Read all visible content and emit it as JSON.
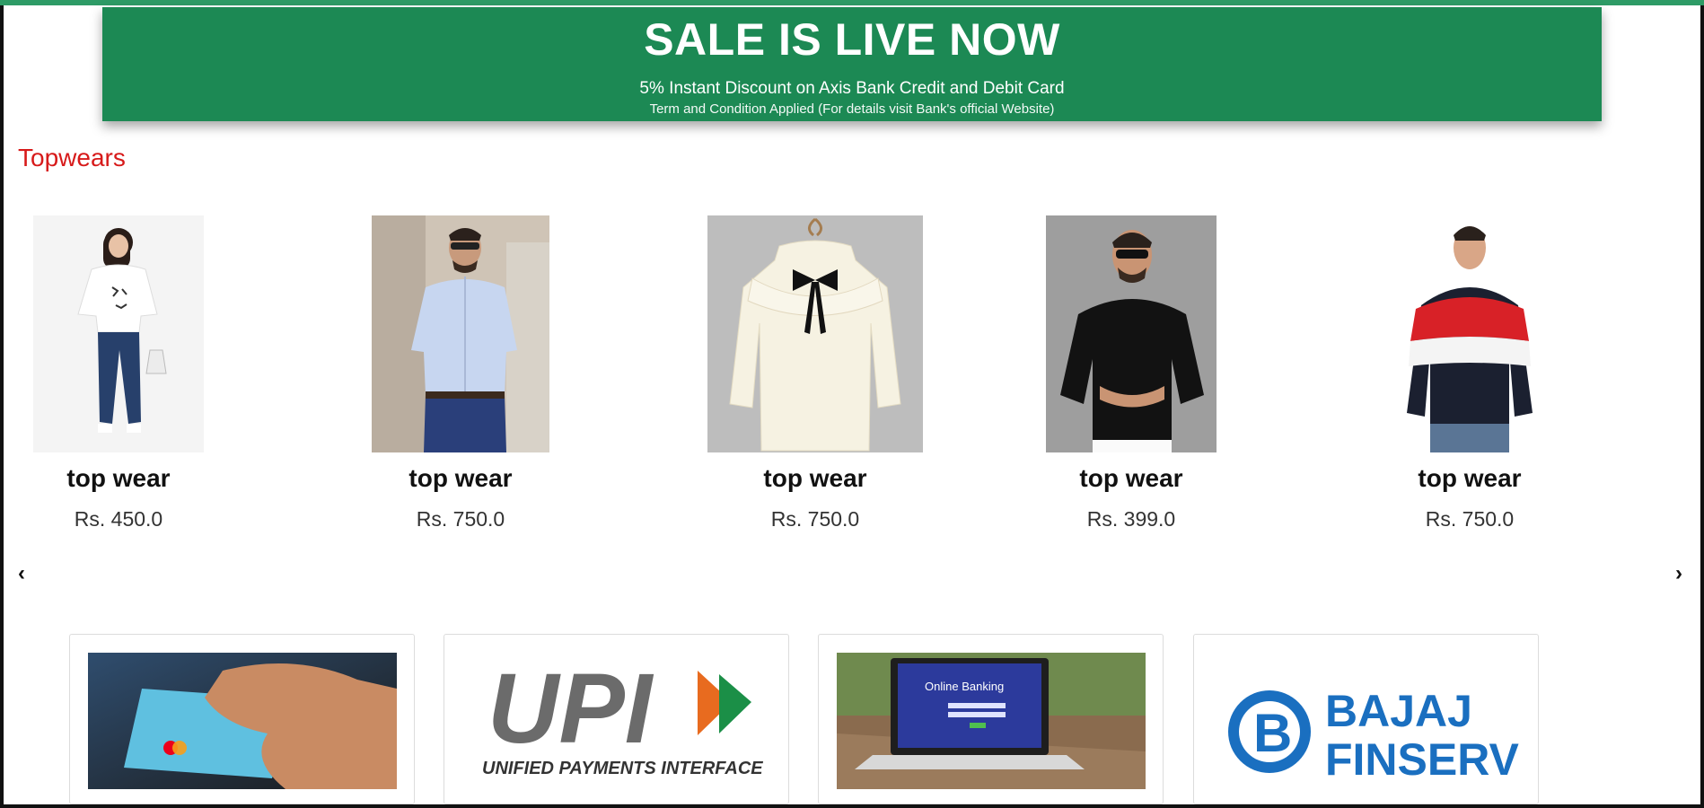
{
  "banner": {
    "title": "SALE IS LIVE NOW",
    "line1": "5% Instant Discount on Axis Bank Credit and Debit Card",
    "line2": "Term and Condition Applied (For details visit Bank's official Website)"
  },
  "section": {
    "title": "Topwears"
  },
  "products": [
    {
      "name": "top wear",
      "price": "Rs. 450.0"
    },
    {
      "name": "top wear",
      "price": "Rs. 750.0"
    },
    {
      "name": "top wear",
      "price": "Rs. 750.0"
    },
    {
      "name": "top wear",
      "price": "Rs. 399.0"
    },
    {
      "name": "top wear",
      "price": "Rs. 750.0"
    }
  ],
  "carousel": {
    "prev": "‹",
    "next": "›"
  },
  "payments": {
    "card": {
      "icon": "credit-card-photo"
    },
    "upi": {
      "logo_text": "UPI",
      "caption": "UNIFIED PAYMENTS INTERFACE"
    },
    "netbanking": {
      "screen_text": "Online Banking"
    },
    "bajaj": {
      "line1": "BAJAJ",
      "line2": "FINSERV"
    }
  },
  "colors": {
    "banner_green": "#1c8954",
    "section_red": "#d71a1a",
    "bajaj_blue": "#1a6fc0",
    "upi_orange": "#e86b1f",
    "upi_green": "#1b8f47"
  }
}
